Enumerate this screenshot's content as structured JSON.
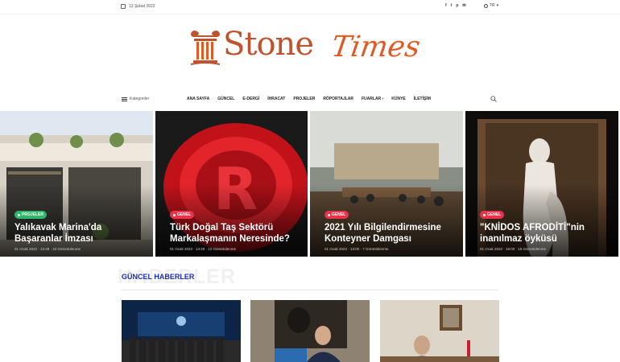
{
  "topbar": {
    "date": "13 Şubat 2022",
    "socials": [
      "f",
      "t",
      "p",
      "✉"
    ],
    "language": "TR"
  },
  "logo": {
    "part1": "Stone",
    "part2": "Times"
  },
  "nav": {
    "categories_label": "Kategoriler",
    "items": [
      "ANA SAYFA",
      "GÜNCEL",
      "E-DERGİ",
      "İHRACAT",
      "PROJELER",
      "RÖPORTAJLAR",
      "FUARLAR",
      "KÜNYE",
      "İLETİŞİM"
    ]
  },
  "hero": [
    {
      "category": "PROJELER",
      "title": "Yalıkavak Marina'da Başaranlar İmzası",
      "meta": "01 Ocak 2022 · 13:48 · 43 Görüntülenme"
    },
    {
      "category": "GENEL",
      "title": "Türk Doğal Taş Sektörü Markalaşmanın Neresinde?",
      "meta": "01 Ocak 2022 · 13:29 · 12 Görüntülenme"
    },
    {
      "category": "GENEL",
      "title": "2021 Yılı Bilgilendirmesine Konteyner Damgası",
      "meta": "01 Ocak 2022 · 13:00 · 7 Görüntülenme"
    },
    {
      "category": "GENEL",
      "title": "\"KNİDOS AFRODİTİ\"nin inanılmaz öyküsü",
      "meta": "01 Ocak 2022 · 18:00 · 18 Görüntülenme"
    }
  ],
  "section": {
    "background_text": "HABERLER",
    "title": "GÜNCEL HABERLER"
  },
  "colors": {
    "accent": "#e15a23",
    "section_title": "#1f2fb8",
    "badge_red": "#e8334a",
    "badge_green": "#2fb66a"
  }
}
